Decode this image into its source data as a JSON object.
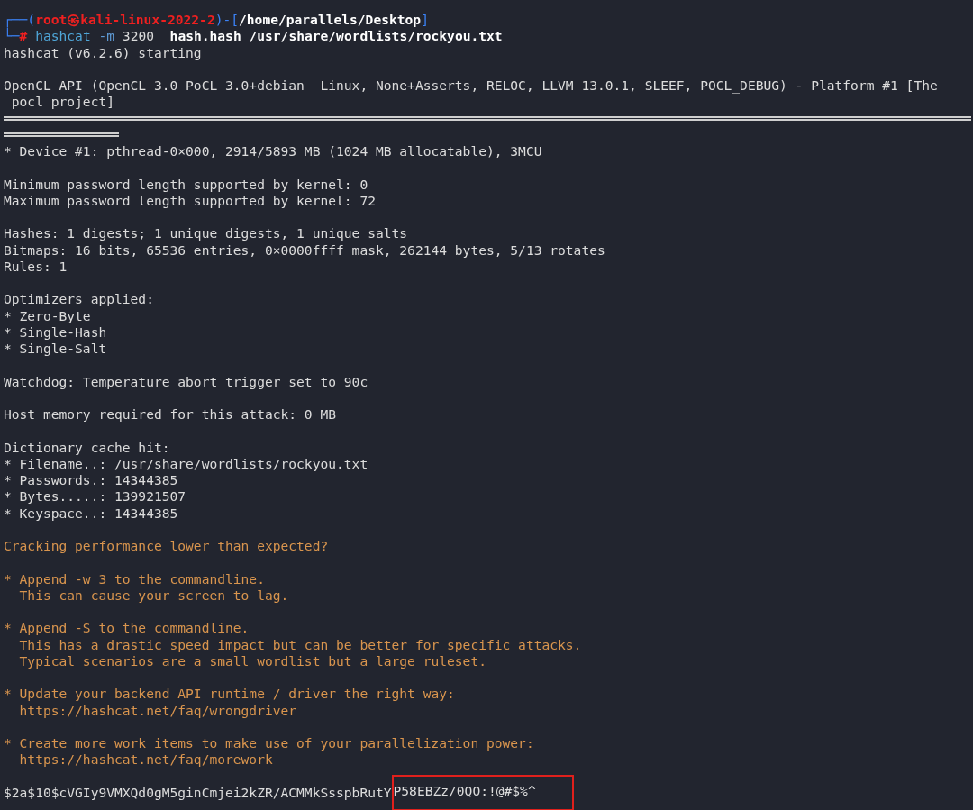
{
  "prompt": {
    "corner_top": "┌──(",
    "user_host": "root㉿kali-linux-2022-2",
    "mid": ")-[",
    "path": "/home/parallels/Desktop",
    "close": "]",
    "corner_bottom": "└─",
    "hash_sign": "#",
    "command": "hashcat",
    "option": "-m",
    "value": "3200",
    "args": "hash.hash /usr/share/wordlists/rockyou.txt"
  },
  "lines": [
    {
      "kind": "normal",
      "text": "hashcat (v6.2.6) starting"
    },
    {
      "kind": "blank"
    },
    {
      "kind": "normal",
      "text": "OpenCL API (OpenCL 3.0 PoCL 3.0+debian  Linux, None+Asserts, RELOC, LLVM 13.0.1, SLEEF, POCL_DEBUG) - Platform #1 [The"
    },
    {
      "kind": "normal",
      "text": " pocl project]"
    },
    {
      "kind": "rule"
    },
    {
      "kind": "rule_short"
    },
    {
      "kind": "normal",
      "text": "* Device #1: pthread-0×000, 2914/5893 MB (1024 MB allocatable), 3MCU"
    },
    {
      "kind": "blank"
    },
    {
      "kind": "normal",
      "text": "Minimum password length supported by kernel: 0"
    },
    {
      "kind": "normal",
      "text": "Maximum password length supported by kernel: 72"
    },
    {
      "kind": "blank"
    },
    {
      "kind": "normal",
      "text": "Hashes: 1 digests; 1 unique digests, 1 unique salts"
    },
    {
      "kind": "normal",
      "text": "Bitmaps: 16 bits, 65536 entries, 0×0000ffff mask, 262144 bytes, 5/13 rotates"
    },
    {
      "kind": "normal",
      "text": "Rules: 1"
    },
    {
      "kind": "blank"
    },
    {
      "kind": "normal",
      "text": "Optimizers applied:"
    },
    {
      "kind": "normal",
      "text": "* Zero-Byte"
    },
    {
      "kind": "normal",
      "text": "* Single-Hash"
    },
    {
      "kind": "normal",
      "text": "* Single-Salt"
    },
    {
      "kind": "blank"
    },
    {
      "kind": "normal",
      "text": "Watchdog: Temperature abort trigger set to 90c"
    },
    {
      "kind": "blank"
    },
    {
      "kind": "normal",
      "text": "Host memory required for this attack: 0 MB"
    },
    {
      "kind": "blank"
    },
    {
      "kind": "normal",
      "text": "Dictionary cache hit:"
    },
    {
      "kind": "normal",
      "text": "* Filename..: /usr/share/wordlists/rockyou.txt"
    },
    {
      "kind": "normal",
      "text": "* Passwords.: 14344385"
    },
    {
      "kind": "normal",
      "text": "* Bytes.....: 139921507"
    },
    {
      "kind": "normal",
      "text": "* Keyspace..: 14344385"
    },
    {
      "kind": "blank"
    },
    {
      "kind": "warning",
      "text": "Cracking performance lower than expected?"
    },
    {
      "kind": "blank"
    },
    {
      "kind": "warning",
      "text": "* Append -w 3 to the commandline."
    },
    {
      "kind": "warning",
      "text": "  This can cause your screen to lag."
    },
    {
      "kind": "blank"
    },
    {
      "kind": "warning",
      "text": "* Append -S to the commandline."
    },
    {
      "kind": "warning",
      "text": "  This has a drastic speed impact but can be better for specific attacks."
    },
    {
      "kind": "warning",
      "text": "  Typical scenarios are a small wordlist but a large ruleset."
    },
    {
      "kind": "blank"
    },
    {
      "kind": "warning",
      "text": "* Update your backend API runtime / driver the right way:"
    },
    {
      "kind": "warning",
      "text": "  https://hashcat.net/faq/wrongdriver"
    },
    {
      "kind": "blank"
    },
    {
      "kind": "warning",
      "text": "* Create more work items to make use of your parallelization power:"
    },
    {
      "kind": "warning",
      "text": "  https://hashcat.net/faq/morework"
    },
    {
      "kind": "blank"
    },
    {
      "kind": "result",
      "text": "$2a$10$cVGIy9VMXQd0gM5ginCmjei2kZR/ACMMkSsspbRutY",
      "highlighted": "P58EBZz/0QO:!@#$%^"
    }
  ]
}
